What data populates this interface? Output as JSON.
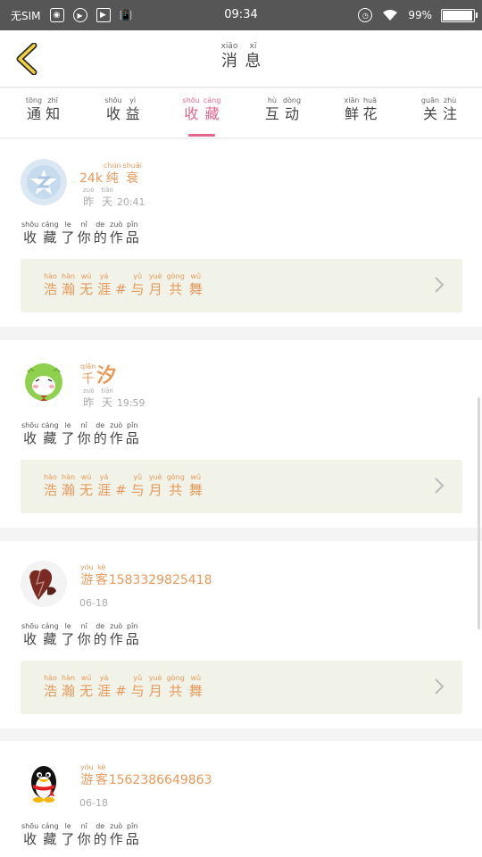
{
  "status_bar": {
    "sim_label": "无SIM",
    "time": "09:34",
    "battery_text": "99%",
    "battery_level": 0.99
  },
  "header": {
    "title": [
      {
        "py": "xiāo",
        "hz": "消"
      },
      {
        "py": "xī",
        "hz": "息"
      }
    ]
  },
  "tabs": [
    {
      "name": "tongzhi",
      "words": [
        {
          "py": "tōng",
          "hz": "通"
        },
        {
          "py": "zhī",
          "hz": "知"
        }
      ],
      "active": false
    },
    {
      "name": "shouyi",
      "words": [
        {
          "py": "shōu",
          "hz": "收"
        },
        {
          "py": "yì",
          "hz": "益"
        }
      ],
      "active": false
    },
    {
      "name": "shoucang",
      "words": [
        {
          "py": "shōu",
          "hz": "收"
        },
        {
          "py": "cáng",
          "hz": "藏"
        }
      ],
      "active": true
    },
    {
      "name": "hudong",
      "words": [
        {
          "py": "hù",
          "hz": "互"
        },
        {
          "py": "dòng",
          "hz": "动"
        }
      ],
      "active": false
    },
    {
      "name": "xianhua",
      "words": [
        {
          "py": "xiān",
          "hz": "鲜"
        },
        {
          "py": "huā",
          "hz": "花"
        }
      ],
      "active": false
    },
    {
      "name": "guanzhu",
      "words": [
        {
          "py": "guān",
          "hz": "关"
        },
        {
          "py": "zhù",
          "hz": "注"
        }
      ],
      "active": false
    }
  ],
  "action_text": [
    {
      "py": "shōu",
      "hz": "收"
    },
    {
      "py": "cáng",
      "hz": "藏"
    },
    {
      "py": "le",
      "hz": "了"
    },
    {
      "py": "nǐ",
      "hz": "你"
    },
    {
      "py": "de",
      "hz": "的"
    },
    {
      "py": "zuò",
      "hz": "作"
    },
    {
      "py": "pǐn",
      "hz": "品"
    }
  ],
  "work_title": [
    {
      "py": "hào",
      "hz": "浩"
    },
    {
      "py": "hàn",
      "hz": "瀚"
    },
    {
      "py": "wú",
      "hz": "无"
    },
    {
      "py": "yá",
      "hz": "涯"
    },
    {
      "py": "",
      "hz": "#"
    },
    {
      "py": "yǔ",
      "hz": "与"
    },
    {
      "py": "yuè",
      "hz": "月"
    },
    {
      "py": "gòng",
      "hz": "共"
    },
    {
      "py": "wǔ",
      "hz": "舞"
    }
  ],
  "notifications": [
    {
      "avatar": "qzone-avatar",
      "user_prefix": "24k",
      "user_words": [
        {
          "py": "chún",
          "hz": "纯"
        },
        {
          "py": "shuǎi",
          "hz": "衰"
        }
      ],
      "user_suffix": "",
      "time_words": [
        {
          "py": "zuó",
          "hz": "昨"
        },
        {
          "py": "tiān",
          "hz": "天"
        }
      ],
      "time_value": "20:41"
    },
    {
      "avatar": "green-cartoon-avatar",
      "user_prefix": "",
      "user_words": [
        {
          "py": "qiān",
          "hz": "千"
        }
      ],
      "user_suffix": "汐",
      "time_words": [
        {
          "py": "zuó",
          "hz": "昨"
        },
        {
          "py": "tiān",
          "hz": "天"
        }
      ],
      "time_value": "19:59"
    },
    {
      "avatar": "heart-photo-avatar",
      "user_prefix": "",
      "user_words": [
        {
          "py": "yóu",
          "hz": "游"
        },
        {
          "py": "kè",
          "hz": "客"
        }
      ],
      "user_suffix": "15833298254​18",
      "time_words": [],
      "time_value": "06-18"
    },
    {
      "avatar": "qq-penguin-avatar",
      "user_prefix": "",
      "user_words": [
        {
          "py": "yóu",
          "hz": "游"
        },
        {
          "py": "kè",
          "hz": "客"
        }
      ],
      "user_suffix": "15623866​49863",
      "time_words": [],
      "time_value": "06-18"
    }
  ]
}
